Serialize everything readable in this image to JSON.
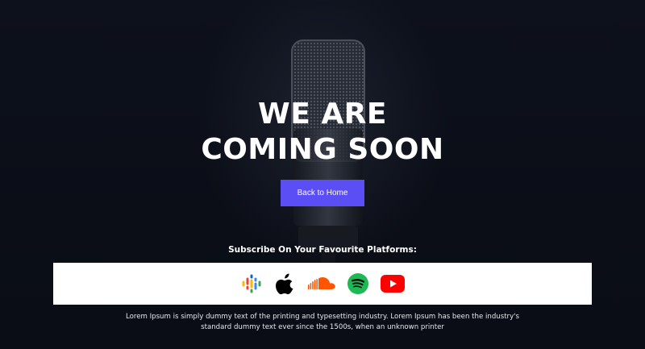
{
  "hero": {
    "title_line1": "WE ARE",
    "title_line2": "COMING SOON",
    "back_button_label": "Back to Home"
  },
  "subscribe": {
    "heading": "Subscribe On Your Favourite Platforms:",
    "platforms": [
      {
        "name": "Google Podcasts",
        "icon": "google-podcasts-icon"
      },
      {
        "name": "Apple Podcasts",
        "icon": "apple-icon"
      },
      {
        "name": "SoundCloud",
        "icon": "soundcloud-icon"
      },
      {
        "name": "Spotify",
        "icon": "spotify-icon"
      },
      {
        "name": "YouTube",
        "icon": "youtube-icon"
      }
    ]
  },
  "footer": {
    "text": "Lorem Ipsum is simply dummy text of the printing and typesetting industry. Lorem Ipsum has been the industry's standard dummy text ever since the 1500s, when an unknown printer"
  },
  "colors": {
    "background": "#0c0f19",
    "accent": "#5b4ef5",
    "spotify": "#1db954",
    "youtube": "#ff0000",
    "soundcloud": "#ff5500"
  }
}
